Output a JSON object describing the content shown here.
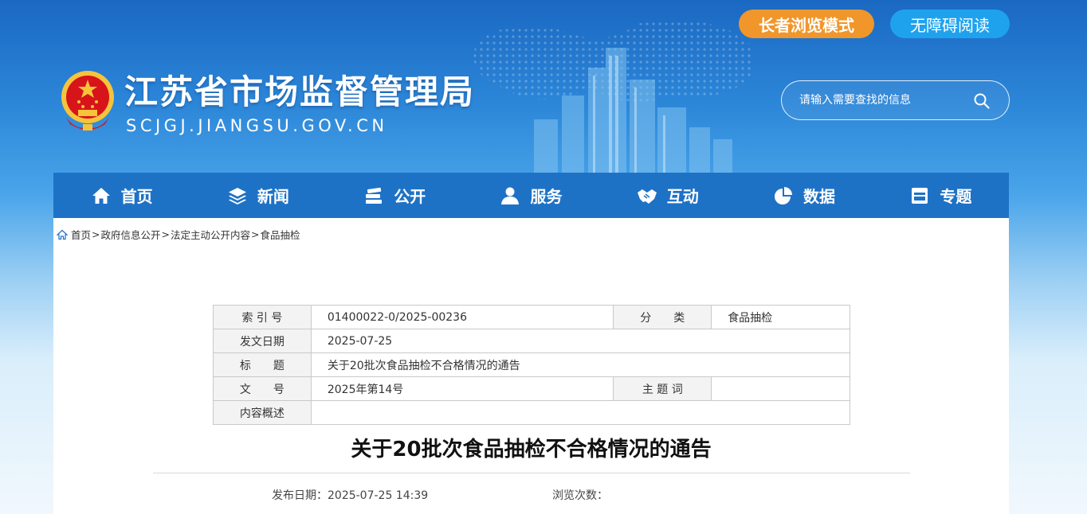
{
  "header": {
    "site_title": "江苏省市场监督管理局",
    "site_domain": "SCJGJ.JIANGSU.GOV.CN",
    "elder_mode": "长者浏览模式",
    "accessibility": "无障碍阅读",
    "search_placeholder": "请输入需要查找的信息"
  },
  "nav": [
    {
      "label": "首页",
      "icon": "home-icon"
    },
    {
      "label": "新闻",
      "icon": "layers-icon"
    },
    {
      "label": "公开",
      "icon": "stack-icon"
    },
    {
      "label": "服务",
      "icon": "user-icon"
    },
    {
      "label": "互动",
      "icon": "handshake-icon"
    },
    {
      "label": "数据",
      "icon": "pie-chart-icon"
    },
    {
      "label": "专题",
      "icon": "calendar-icon"
    }
  ],
  "breadcrumb": [
    "首页",
    "政府信息公开",
    "法定主动公开内容",
    "食品抽检"
  ],
  "meta": {
    "index_label": "索 引 号",
    "index_value": "01400022-0/2025-00236",
    "category_label": "分　　类",
    "category_value": "食品抽检",
    "date_label": "发文日期",
    "date_value": "2025-07-25",
    "title_label": "标　　题",
    "title_value": "关于20批次食品抽检不合格情况的通告",
    "docno_label": "文　　号",
    "docno_value": "2025年第14号",
    "topic_label": "主 题 词",
    "topic_value": "",
    "summary_label": "内容概述",
    "summary_value": ""
  },
  "article": {
    "title": "关于20批次食品抽检不合格情况的通告",
    "publish": "发布日期：2025-07-25 14:39",
    "views": "浏览次数："
  },
  "colors": {
    "nav_bg": "#1e72c6",
    "elder_btn": "#f0962a",
    "access_btn": "#1fa2ee",
    "emblem_red": "#d8141b",
    "emblem_gold": "#f5c43b"
  }
}
